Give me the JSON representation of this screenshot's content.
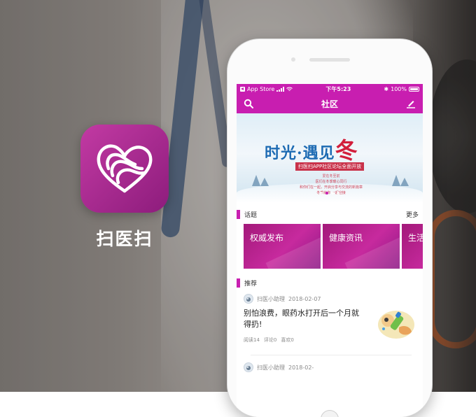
{
  "app": {
    "name": "扫医扫"
  },
  "status_bar": {
    "back_app": "App Store",
    "time": "下午5:23",
    "battery": "100%"
  },
  "nav": {
    "title": "社区",
    "left_icon": "search-icon",
    "right_icon": "edit-icon"
  },
  "banner": {
    "title_part1": "时光·遇见",
    "title_part2": "冬",
    "tag": "扫医扫APP社区论坛全面开放",
    "lines": [
      "爱在冬至前",
      "医们在冬季暖心同行",
      "和你们在一起，开启分享与交流的新篇章",
      "冬季给你 一起迎接"
    ],
    "active_slide": 1,
    "slide_count": 4
  },
  "topics_section": {
    "title": "话题",
    "more": "更多",
    "items": [
      "权威发布",
      "健康资讯",
      "生活"
    ]
  },
  "recommend_section": {
    "title": "推荐"
  },
  "feed": [
    {
      "author": "扫医小助理",
      "date": "2018-02-07",
      "title": "别怕浪费，眼药水打开后一个月就得扔!",
      "reads": "阅读14",
      "comments": "评论0",
      "likes": "喜欢0"
    },
    {
      "author": "扫医小助理",
      "date": "2018-02-"
    }
  ],
  "colors": {
    "brand": "#c81eb0",
    "icon_bg": "#b02f9a"
  }
}
